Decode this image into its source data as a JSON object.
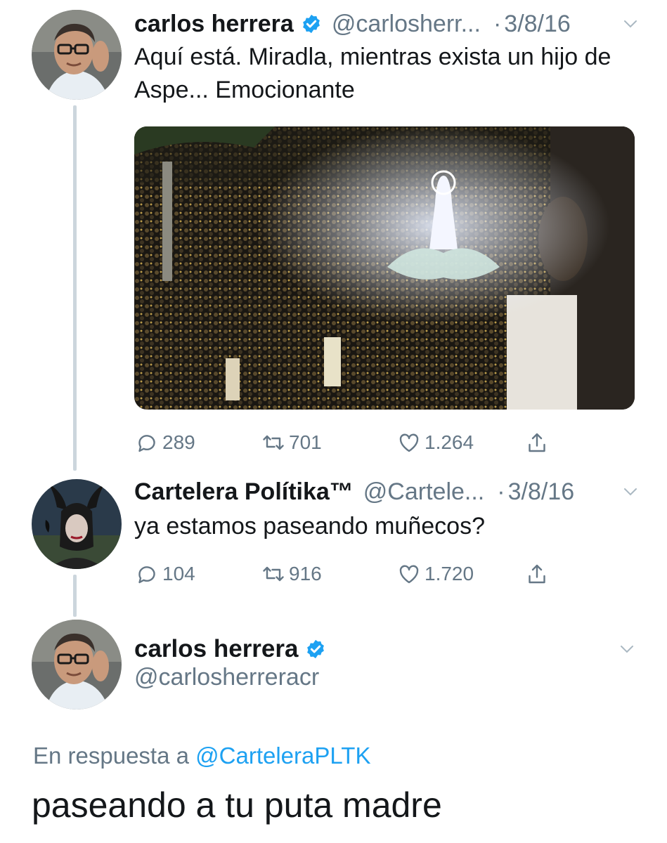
{
  "tweets": [
    {
      "display_name": "carlos herrera",
      "handle": "@carlosherr...",
      "separator": "·",
      "date": "3/8/16",
      "text": "Aquí está. Miradla, mientras exista un hijo de Aspe... Emocionante",
      "actions": {
        "replies": "289",
        "retweets": "701",
        "likes": "1.264"
      }
    },
    {
      "display_name": "Cartelera Polítika™",
      "handle": "@Cartele...",
      "separator": "·",
      "date": "3/8/16",
      "text": "ya estamos paseando muñecos?",
      "actions": {
        "replies": "104",
        "retweets": "916",
        "likes": "1.720"
      }
    }
  ],
  "focused_tweet": {
    "display_name": "carlos herrera",
    "handle": "@carlosherreracr",
    "reply_prefix": "En respuesta a",
    "reply_mention": "@CarteleraPLTK",
    "text": "paseando a tu puta madre"
  },
  "colors": {
    "accent": "#1da1f2",
    "secondary_text": "#657786",
    "thread_line": "#ccd6dd"
  },
  "icons": [
    "verified-badge-icon",
    "chevron-down-icon",
    "reply-icon",
    "retweet-icon",
    "like-icon",
    "share-icon"
  ]
}
